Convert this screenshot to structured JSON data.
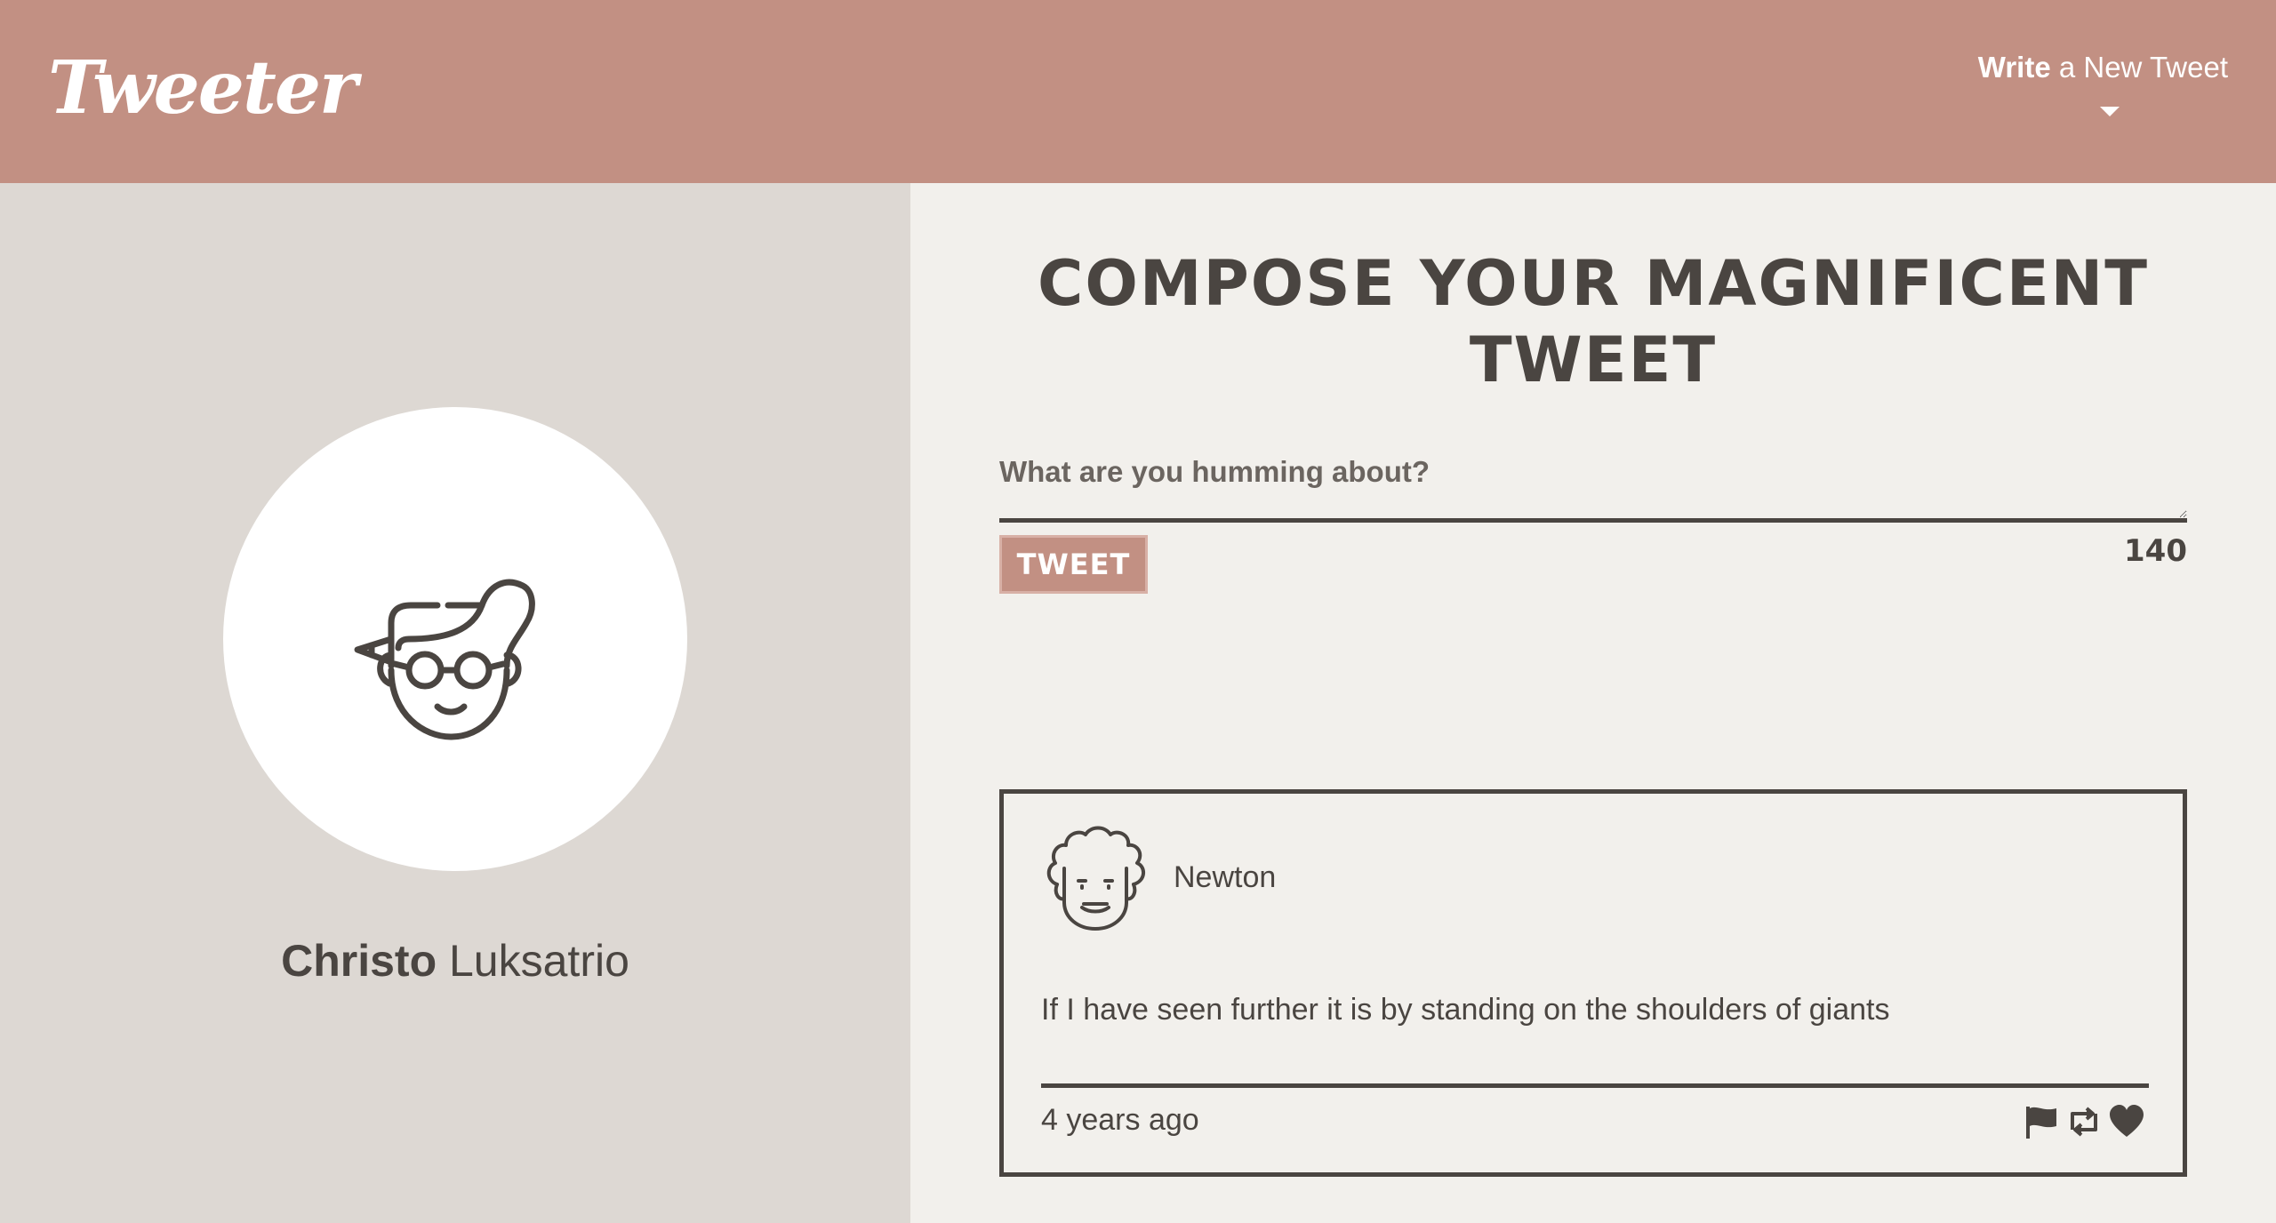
{
  "nav": {
    "logo": "Tweeter",
    "write_bold": "Write",
    "write_rest": " a New Tweet"
  },
  "profile": {
    "first_name": "Christo",
    "last_name": " Luksatrio"
  },
  "compose": {
    "title": "Compose your magnificent tweet",
    "placeholder": "What are you humming about?",
    "button_label": "Tweet",
    "counter": "140"
  },
  "tweets": [
    {
      "author": "Newton",
      "content": "If I have seen further it is by standing on the shoulders of giants",
      "time": "4 years ago",
      "actions": [
        "flag-icon",
        "retweet-icon",
        "heart-icon"
      ]
    }
  ],
  "colors": {
    "brand": "#c29083",
    "text": "#4a4541",
    "sidebar": "#ddd8d3",
    "background": "#f2f0ec"
  }
}
